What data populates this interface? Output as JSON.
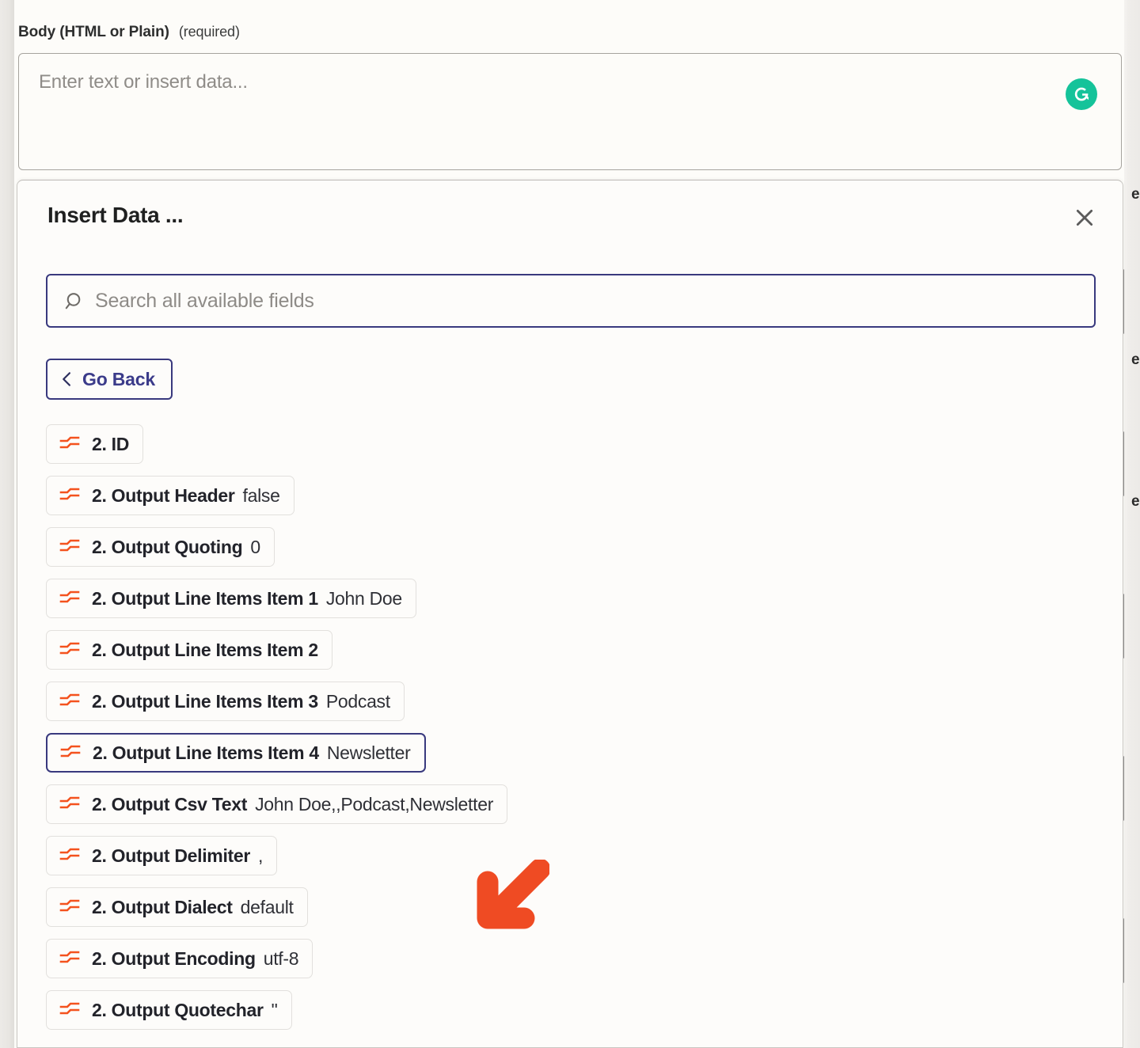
{
  "field": {
    "label": "Body (HTML or Plain)",
    "required_note": "(required)",
    "placeholder": "Enter text or insert data...",
    "value": "",
    "assistant_icon": "grammarly-icon"
  },
  "modal": {
    "title": "Insert Data ...",
    "close_label": "×",
    "close_icon": "close-icon",
    "search": {
      "placeholder": "Search all available fields",
      "value": "",
      "icon": "search-icon"
    },
    "go_back": {
      "label": "Go Back",
      "icon": "chevron-left-icon"
    },
    "field_icon": "data-transform-icon",
    "fields": [
      {
        "name": "2. ID",
        "value": ""
      },
      {
        "name": "2. Output Header",
        "value": "false"
      },
      {
        "name": "2. Output Quoting",
        "value": "0"
      },
      {
        "name": "2. Output Line Items Item 1",
        "value": "John Doe"
      },
      {
        "name": "2. Output Line Items Item 2",
        "value": ""
      },
      {
        "name": "2. Output Line Items Item 3",
        "value": "Podcast"
      },
      {
        "name": "2. Output Line Items Item 4",
        "value": "Newsletter",
        "selected": true
      },
      {
        "name": "2. Output Csv Text",
        "value": "John Doe,,Podcast,Newsletter"
      },
      {
        "name": "2. Output Delimiter",
        "value": ","
      },
      {
        "name": "2. Output Dialect",
        "value": "default"
      },
      {
        "name": "2. Output Encoding",
        "value": "utf-8"
      },
      {
        "name": "2. Output Quotechar",
        "value": "\""
      }
    ]
  },
  "annotation": {
    "arrow": "arrow-down-left",
    "points_to": "2. Output Line Items Item 4"
  },
  "background_fragments": {
    "right_edge_glyphs": [
      "e",
      "e",
      "e"
    ]
  },
  "colors": {
    "accent_navy": "#39397e",
    "field_icon_orange": "#f4521e",
    "annotation_orange": "#ef4b23",
    "assistant_green": "#15c39a",
    "page_bg": "#fdfcf9"
  }
}
